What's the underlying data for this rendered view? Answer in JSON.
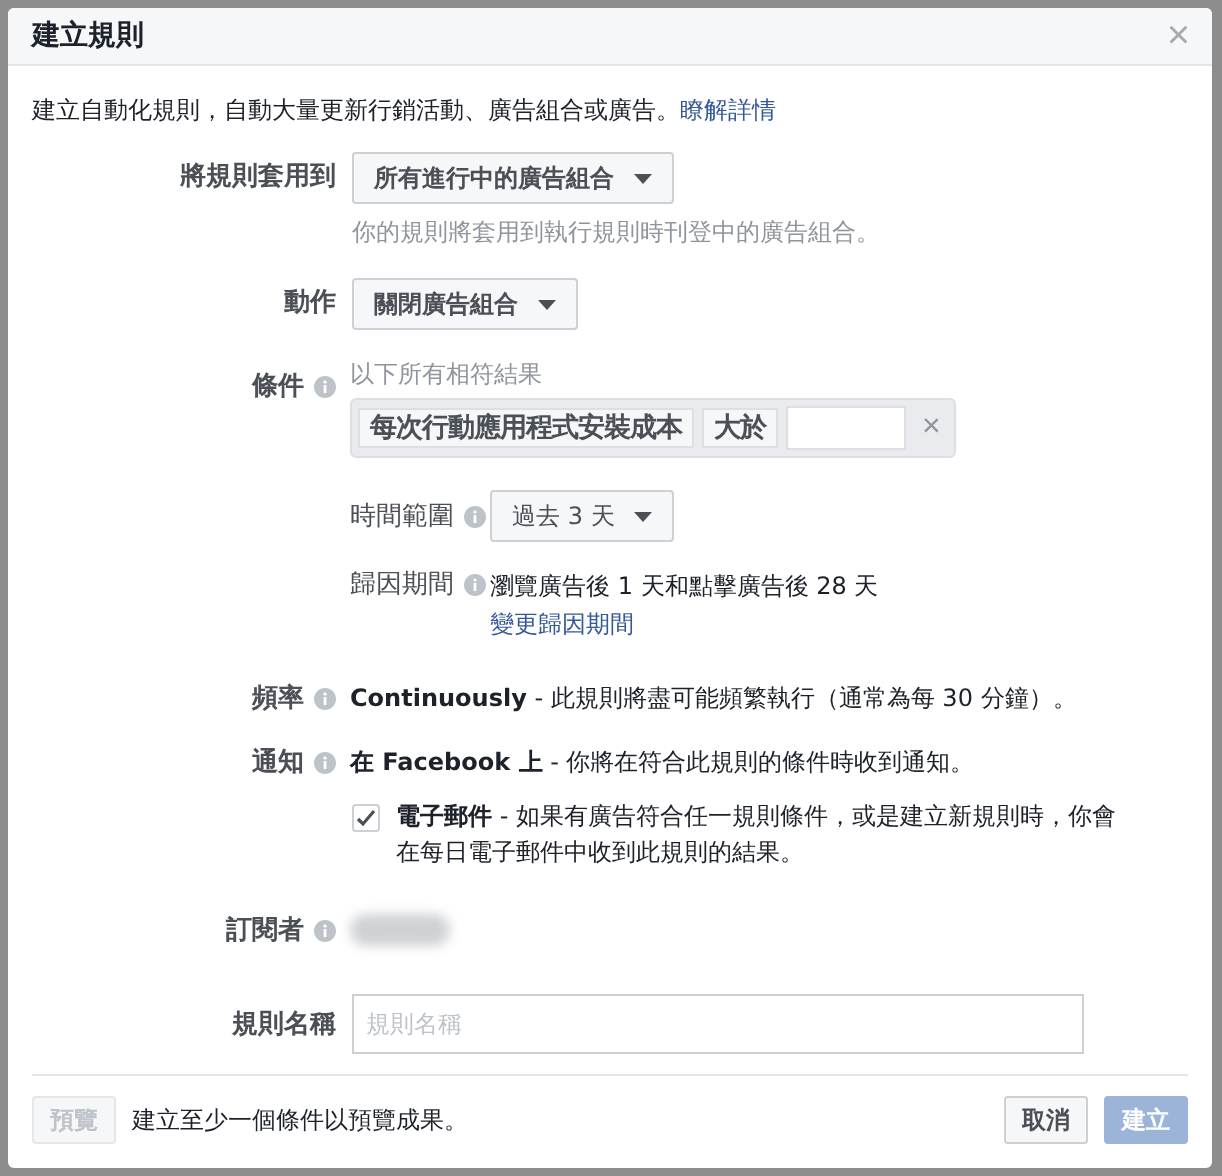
{
  "dialog": {
    "title": "建立規則",
    "close": "×"
  },
  "intro": {
    "text": "建立自動化規則，自動大量更新行銷活動、廣告組合或廣告。",
    "link": "瞭解詳情"
  },
  "apply_to": {
    "label": "將規則套用到",
    "dropdown": "所有進行中的廣告組合",
    "hint": "你的規則將套用到執行規則時刊登中的廣告組合。"
  },
  "action": {
    "label": "動作",
    "dropdown": "關閉廣告組合"
  },
  "conditions": {
    "label": "條件",
    "summary": "以下所有相符結果",
    "condition": {
      "metric": "每次行動應用程式安裝成本",
      "operator": "大於",
      "remove": "×"
    },
    "time_range": {
      "label": "時間範圍",
      "dropdown": "過去 3 天"
    },
    "attribution": {
      "label": "歸因期間",
      "text": "瀏覽廣告後 1 天和點擊廣告後 28 天",
      "link": "變更歸因期間"
    }
  },
  "frequency": {
    "label": "頻率",
    "text": "**Continuously** - 此規則將盡可能頻繁執行（通常為每 30 分鐘）。"
  },
  "notification": {
    "label": "通知",
    "text": "**在 Facebook 上** - 你將在符合此規則的條件時收到通知。",
    "email": {
      "checked": true,
      "text": "**電子郵件** - 如果有廣告符合任一規則條件，或是建立新規則時，你會在每日電子郵件中收到此規則的結果。"
    }
  },
  "subscriber": {
    "label": "訂閱者"
  },
  "rule_name": {
    "label": "規則名稱",
    "placeholder": "規則名稱"
  },
  "footer": {
    "preview": {
      "label": "預覽",
      "disabled": true
    },
    "hint": "建立至少一個條件以預覽成果。",
    "cancel": "取消",
    "create": {
      "label": "建立",
      "disabled": true
    }
  }
}
